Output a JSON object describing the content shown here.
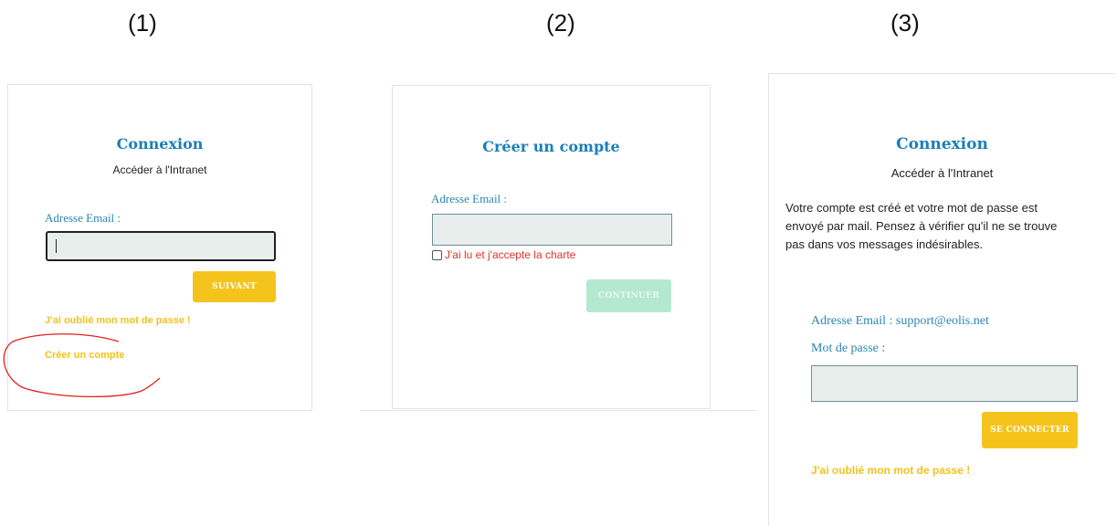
{
  "steps": [
    "(1)",
    "(2)",
    "(3)"
  ],
  "panel1": {
    "title": "Connexion",
    "subtitle": "Accéder à l'Intranet",
    "email_label": "Adresse Email :",
    "email_value": "",
    "next_button": "SUIVANT",
    "forgot_link": "J'ai oublié mon mot de passe !",
    "create_link": "Créer un compte"
  },
  "panel2": {
    "title": "Créer un compte",
    "email_label": "Adresse Email :",
    "email_value": "",
    "checkbox_label": "J'ai lu et j'accepte la charte",
    "checkbox_checked": false,
    "continue_button": "CONTINUER"
  },
  "panel3": {
    "title": "Connexion",
    "subtitle": "Accéder à l'Intranet",
    "message": "Votre compte est créé et votre mot de passe est envoyé par mail. Pensez à vérifier qu'il ne se trouve pas dans vos messages indésirables.",
    "email_label": "Adresse Email : support@eolis.net",
    "password_label": "Mot de passe :",
    "password_value": "",
    "connect_button": "SE CONNECTER",
    "forgot_link": "J'ai oublié mon mot de passe !"
  },
  "colors": {
    "title": "#1a7fb7",
    "button_yellow": "#f4c41c",
    "button_disabled": "#b5e9cf",
    "error_red": "#d9342b",
    "annotation_red": "#e02020"
  }
}
